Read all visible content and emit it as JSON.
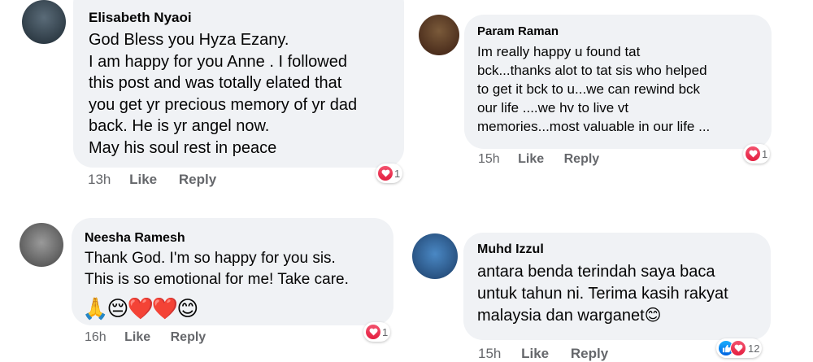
{
  "comments": [
    {
      "author": "Elisabeth Nyaoi",
      "lines": [
        "God Bless you Hyza Ezany.",
        "I am happy for you Anne . I followed",
        "this post and was totally elated that",
        "you get yr precious memory of yr dad",
        "back. He is yr angel  now.",
        "May his soul rest in peace"
      ],
      "time": "13h",
      "like": "Like",
      "reply": "Reply",
      "reaction_count": "1"
    },
    {
      "author": "Param Raman",
      "lines": [
        "Im really happy u found tat",
        "bck...thanks alot to tat sis who helped",
        "to get it bck to u...we can rewind bck",
        "our life ....we hv to live vt",
        "memories...most valuable in our life ..."
      ],
      "time": "15h",
      "like": "Like",
      "reply": "Reply",
      "reaction_count": "1"
    },
    {
      "author": "Neesha Ramesh",
      "lines": [
        "Thank God. I'm so happy for you sis.",
        "This is so emotional for me! Take care."
      ],
      "emojis": "🙏😔❤️❤️😊",
      "time": "16h",
      "like": "Like",
      "reply": "Reply",
      "reaction_count": "1"
    },
    {
      "author": "Muhd Izzul",
      "lines": [
        "antara benda terindah saya baca",
        "untuk tahun ni. Terima kasih rakyat",
        "malaysia dan warganet😊"
      ],
      "time": "15h",
      "like": "Like",
      "reply": "Reply",
      "reaction_count": "12"
    }
  ],
  "icons": [
    "heart-reaction-icon",
    "like-reaction-icon"
  ],
  "colors": {
    "bubble": "#f0f2f5",
    "secondary_text": "#65676b",
    "heart": "#e41e3f",
    "like": "#0062df"
  }
}
